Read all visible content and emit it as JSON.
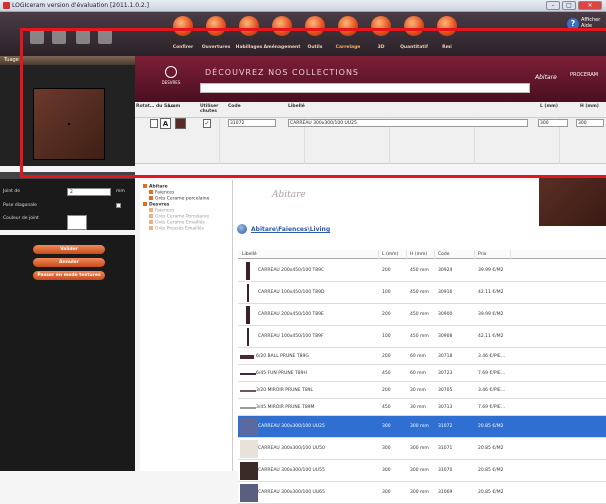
{
  "window": {
    "title": "LOGIceram version d'évaluation [2011.1.0.2.]",
    "help_label_1": "Afficher",
    "help_label_2": "Aide"
  },
  "toolbar": {
    "items": [
      {
        "label": "Confirer",
        "active": false
      },
      {
        "label": "Ouvertures",
        "active": false
      },
      {
        "label": "Habillages",
        "active": false
      },
      {
        "label": "Aménagement",
        "active": false
      },
      {
        "label": "Outils",
        "active": false
      },
      {
        "label": "Carrelage",
        "active": true
      },
      {
        "label": "3D",
        "active": false
      },
      {
        "label": "Quantitatif",
        "active": false
      },
      {
        "label": "Rmi",
        "active": false
      }
    ],
    "accent": "#e04a1a"
  },
  "left_panel": {
    "header": "Tuage"
  },
  "banner": {
    "brand": "DESVRES",
    "slogan": "DÉCOUVREZ NOS COLLECTIONS",
    "brand2": "Abitare",
    "brand3": "PROCERAM"
  },
  "properties": {
    "headers": {
      "rotate": "Rotat… du Sa…",
      "lmm": "Lmm",
      "use": "Utiliser chutes",
      "code": "Code",
      "label": "Libellé",
      "l": "L (mm)",
      "h": "H (mm)"
    },
    "values": {
      "letter": "A",
      "code": "31072",
      "label": "CARREAU 300x300/100   UU25",
      "l": "300",
      "h": "300"
    }
  },
  "joint": {
    "joint_label": "Joint de",
    "joint_value": "2",
    "joint_unit": "mm",
    "diagonal_label": "Pose diagonale",
    "color_label": "Couleur de joint"
  },
  "actions": {
    "validate": "Valider",
    "cancel": "Annuler",
    "textures": "Passer en mode textures"
  },
  "tree": {
    "items": [
      {
        "label": "Abitare",
        "level": 0,
        "muted": false
      },
      {
        "label": "Faiences",
        "level": 1,
        "muted": false
      },
      {
        "label": "Grès Cerame porcelaine",
        "level": 1,
        "muted": false
      },
      {
        "label": "Desvres",
        "level": 0,
        "muted": false
      },
      {
        "label": "Faiences",
        "level": 1,
        "muted": true
      },
      {
        "label": "Grès Cerame Porcelaine",
        "level": 1,
        "muted": true
      },
      {
        "label": "Grès Cerame Emaillés",
        "level": 1,
        "muted": true
      },
      {
        "label": "Grès Pressés Emaillés",
        "level": 1,
        "muted": true
      }
    ]
  },
  "main": {
    "logo": "Abitare",
    "breadcrumb": "Abitare\\Faiences\\Living",
    "columns": {
      "label": "Libellé",
      "l": "L (mm)",
      "h": "H (mm)",
      "code": "Code",
      "price": "Prix"
    },
    "rows": [
      {
        "label": "CARREAU 200x450/100   T89C",
        "l": "200",
        "h": "450 mm",
        "code": "30924",
        "price": "39.99 €/M2",
        "selected": false,
        "swatch": "#3a2028",
        "kind": "tall"
      },
      {
        "label": "CARREAU 100x450/100   T89D",
        "l": "100",
        "h": "450 mm",
        "code": "30916",
        "price": "42.11 €/M2",
        "selected": false,
        "swatch": "#3a2028",
        "kind": "thin"
      },
      {
        "label": "CARREAU 200x450/100   T89E",
        "l": "200",
        "h": "450 mm",
        "code": "30900",
        "price": "39.99 €/M2",
        "selected": false,
        "swatch": "#3a2028",
        "kind": "tall"
      },
      {
        "label": "CARREAU 100x450/100   T89F",
        "l": "100",
        "h": "450 mm",
        "code": "30908",
        "price": "42.11 €/M2",
        "selected": false,
        "swatch": "#3a2028",
        "kind": "thin"
      },
      {
        "label": "6/20 BALL PRUNE   T89G",
        "l": "200",
        "h": "60 mm",
        "code": "30718",
        "price": "3.46 €/PIE…",
        "selected": false,
        "swatch": "#4a2a30",
        "kind": "bar"
      },
      {
        "label": "6/45 FUN PRUNE   T89H",
        "l": "450",
        "h": "60 mm",
        "code": "30723",
        "price": "7.69 €/PIE…",
        "selected": false,
        "swatch": "#3a2a40",
        "kind": "line"
      },
      {
        "label": "3/20 MIROIR PRUNE   T89L",
        "l": "200",
        "h": "30 mm",
        "code": "30705",
        "price": "3.46 €/PIE…",
        "selected": false,
        "swatch": "#6a5a60",
        "kind": "line"
      },
      {
        "label": "3/45 MIROIR PRUNE   T89M",
        "l": "450",
        "h": "30 mm",
        "code": "30713",
        "price": "7.69 €/PIE…",
        "selected": false,
        "swatch": "#9a9a9a",
        "kind": "line"
      },
      {
        "label": "CARREAU 300x300/100   UU25",
        "l": "300",
        "h": "300 mm",
        "code": "31072",
        "price": "20.85 €/M2",
        "selected": true,
        "swatch": "#5a6aa0",
        "kind": "square"
      },
      {
        "label": "CARREAU 300x300/100   UU50",
        "l": "300",
        "h": "300 mm",
        "code": "31071",
        "price": "20.85 €/M2",
        "selected": false,
        "swatch": "#e8e2da",
        "kind": "square"
      },
      {
        "label": "CARREAU 300x300/100   UU55",
        "l": "300",
        "h": "300 mm",
        "code": "31070",
        "price": "20.85 €/M2",
        "selected": false,
        "swatch": "#3a2a28",
        "kind": "square"
      },
      {
        "label": "CARREAU 300x300/100   UU65",
        "l": "300",
        "h": "300 mm",
        "code": "31069",
        "price": "20.85 €/M2",
        "selected": false,
        "swatch": "#5a5f80",
        "kind": "square"
      }
    ]
  },
  "highlight": {
    "color": "#e6141b"
  }
}
